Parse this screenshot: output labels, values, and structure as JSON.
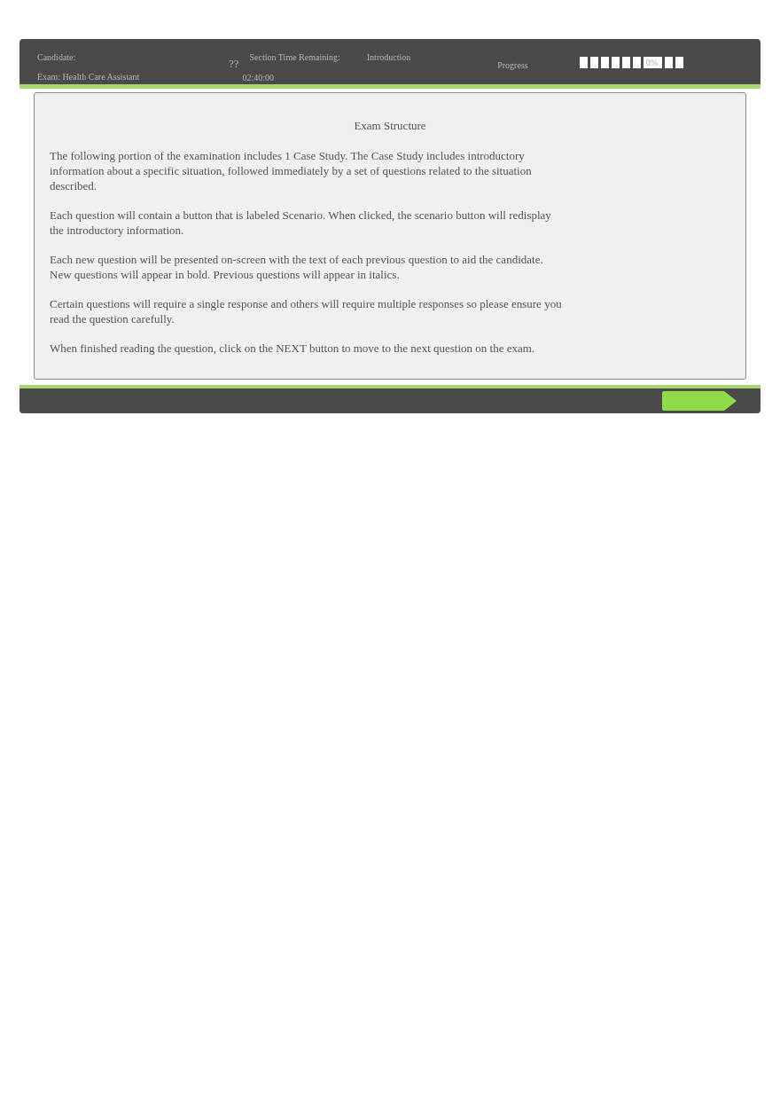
{
  "header": {
    "candidate_label": "Candidate:",
    "exam": "Exam: Health Care Assistant",
    "help": "??",
    "time_label": "Section Time Remaining:",
    "time": "02:40:00",
    "section": "Introduction",
    "progress_label": "Progress",
    "progress": {
      "level": 0,
      "reading": "0%"
    }
  },
  "content": {
    "title": "Exam Structure",
    "paragraphs": [
      "The following portion of the examination includes 1 Case Study. The Case Study includes introductory information about a specific situation, followed immediately by a set of questions related to the situation described.",
      "Each question will contain a button that is labeled Scenario. When clicked, the scenario button will redisplay the introductory information.",
      "Each new question will be presented on-screen with the text of each previous question to aid the candidate. New questions will appear in bold. Previous questions will appear in italics.",
      "Certain questions will require a single response and others will require multiple responses so please ensure you read the question carefully.",
      "When finished reading the question, click on the NEXT button to move to the next question on the exam."
    ]
  }
}
